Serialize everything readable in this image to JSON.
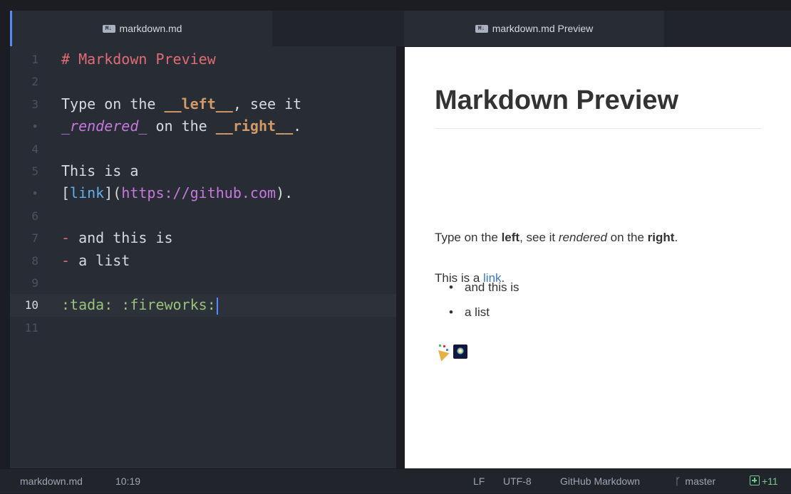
{
  "editor": {
    "tab_title": "markdown.md",
    "tab_icon": "markdown-file-icon",
    "lines": [
      {
        "num": "1",
        "segments": [
          {
            "text": "# Markdown Preview",
            "cls": "c-head"
          }
        ]
      },
      {
        "num": "2",
        "segments": []
      },
      {
        "num": "3",
        "segments": [
          {
            "text": "Type on the ",
            "cls": ""
          },
          {
            "text": "__left__",
            "cls": "c-bold"
          },
          {
            "text": ", see it",
            "cls": ""
          }
        ]
      },
      {
        "num": "•",
        "segments": [
          {
            "text": "_rendered_",
            "cls": "c-ital"
          },
          {
            "text": " on the ",
            "cls": ""
          },
          {
            "text": "__right__",
            "cls": "c-bold"
          },
          {
            "text": ".",
            "cls": ""
          }
        ]
      },
      {
        "num": "4",
        "segments": []
      },
      {
        "num": "5",
        "segments": [
          {
            "text": "This is a",
            "cls": ""
          }
        ]
      },
      {
        "num": "•",
        "segments": [
          {
            "text": "[",
            "cls": ""
          },
          {
            "text": "link",
            "cls": "c-link"
          },
          {
            "text": "](",
            "cls": ""
          },
          {
            "text": "https://github.com",
            "cls": "c-url"
          },
          {
            "text": ").",
            "cls": ""
          }
        ]
      },
      {
        "num": "6",
        "segments": []
      },
      {
        "num": "7",
        "segments": [
          {
            "text": "-",
            "cls": "c-dash"
          },
          {
            "text": " and this is",
            "cls": ""
          }
        ]
      },
      {
        "num": "8",
        "segments": [
          {
            "text": "-",
            "cls": "c-dash"
          },
          {
            "text": " a list",
            "cls": ""
          }
        ]
      },
      {
        "num": "9",
        "segments": []
      },
      {
        "num": "10",
        "active": true,
        "segments": [
          {
            "text": ":tada: :fireworks:",
            "cls": "c-emoji"
          }
        ]
      },
      {
        "num": "11",
        "segments": []
      }
    ]
  },
  "preview": {
    "tab_title": "markdown.md Preview",
    "heading": "Markdown Preview",
    "para1": {
      "a": "Type on the ",
      "b": "left",
      "c": ", see it ",
      "d": "rendered",
      "e": " on the ",
      "f": "right",
      "g": "."
    },
    "para2": {
      "a": "This is a ",
      "link": "link",
      "end": "."
    },
    "list": [
      "and this is",
      "a list"
    ]
  },
  "status": {
    "file": "markdown.md",
    "position": "10:19",
    "line_ending": "LF",
    "encoding": "UTF-8",
    "grammar": "GitHub Markdown",
    "branch": "master",
    "diff": "+11"
  },
  "colors": {
    "accent": "#568af2",
    "editor_bg": "#282c34",
    "heading": "#e06c75",
    "bold": "#d19a66",
    "italic": "#c678dd",
    "link": "#61afef",
    "emoji_text": "#98c379",
    "preview_link": "#4078c0",
    "git_added": "#73c990"
  }
}
